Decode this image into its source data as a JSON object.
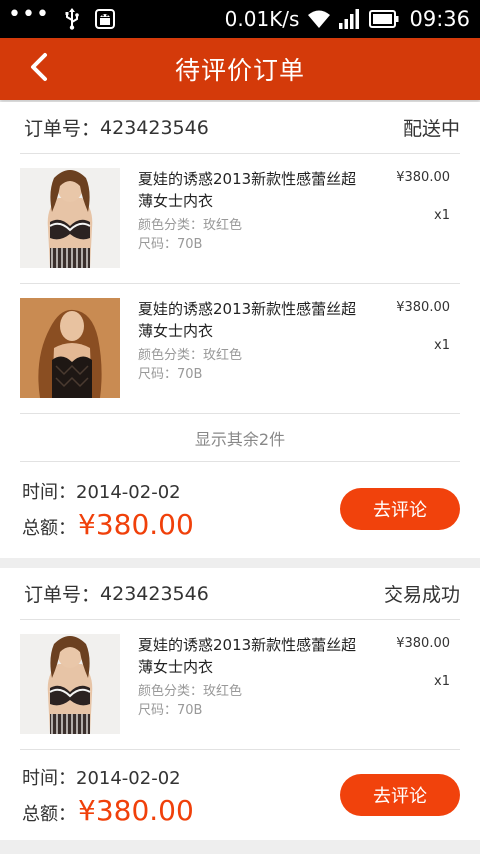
{
  "status_bar": {
    "dots": "•••",
    "speed": "0.01K/s",
    "time": "09:36",
    "icons": [
      "usb-icon",
      "android-debug-icon",
      "wifi-icon",
      "signal-icon",
      "battery-icon"
    ]
  },
  "header": {
    "title": "待评价订单",
    "back_icon": "back-arrow-icon",
    "color": "#d43a0a"
  },
  "orders": [
    {
      "label": "订单号：",
      "number": "423423546",
      "status": "配送中",
      "products": [
        {
          "title": "夏娃的诱惑2013新款性感蕾丝超薄女士内衣",
          "color_attr": "颜色分类：玫红色",
          "size_attr": "尺码：70B",
          "price": "¥380.00",
          "qty": "x1"
        },
        {
          "title": "夏娃的诱惑2013新款性感蕾丝超薄女士内衣",
          "color_attr": "颜色分类：玫红色",
          "size_attr": "尺码：70B",
          "price": "¥380.00",
          "qty": "x1"
        }
      ],
      "show_more": "显示其余2件",
      "time": "时间：2014-02-02",
      "total_label": "总额：",
      "total": "¥380.00",
      "button": "去评论"
    },
    {
      "label": "订单号：",
      "number": "423423546",
      "status": "交易成功",
      "products": [
        {
          "title": "夏娃的诱惑2013新款性感蕾丝超薄女士内衣",
          "color_attr": "颜色分类：玫红色",
          "size_attr": "尺码：70B",
          "price": "¥380.00",
          "qty": "x1"
        }
      ],
      "time": "时间：2014-02-02",
      "total_label": "总额：",
      "total": "¥380.00",
      "button": "去评论"
    }
  ],
  "colors": {
    "accent": "#f1420c",
    "price": "#f0400a",
    "header": "#d43a0a"
  }
}
